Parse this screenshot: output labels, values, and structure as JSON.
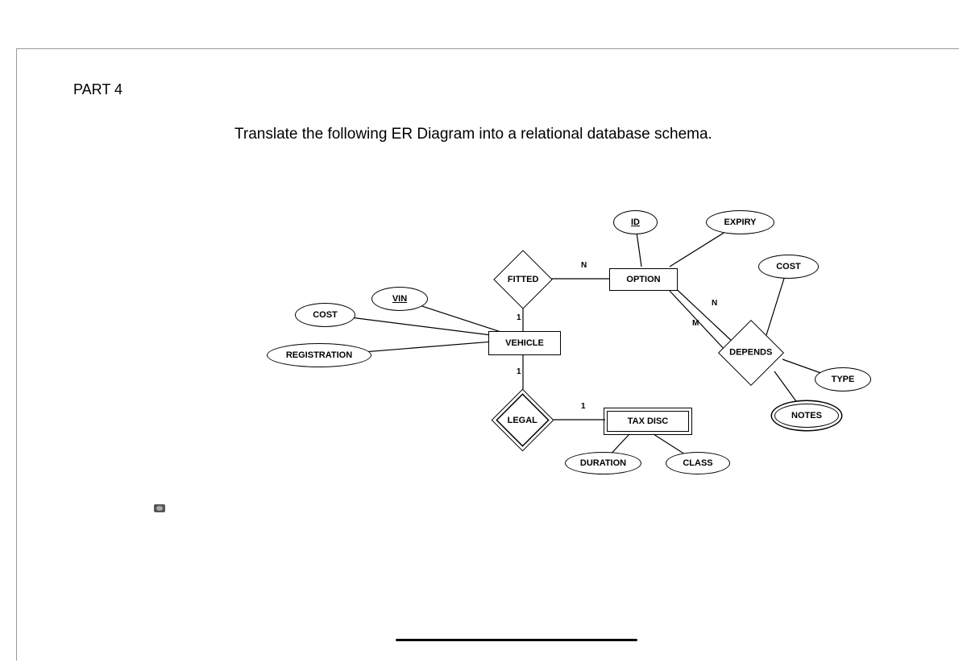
{
  "header": {
    "part": "PART 4"
  },
  "prompt": "Translate the following ER Diagram into a relational database schema.",
  "er": {
    "entities": {
      "vehicle": "VEHICLE",
      "option": "OPTION",
      "tax_disc": "TAX DISC"
    },
    "relationships": {
      "fitted": "FITTED",
      "depends": "DEPENDS",
      "legal": "LEGAL"
    },
    "attributes": {
      "vin": "VIN",
      "cost_vehicle": "COST",
      "registration": "REGISTRATION",
      "id": "ID",
      "expiry": "EXPIRY",
      "cost_depends": "COST",
      "type": "TYPE",
      "notes": "NOTES",
      "duration": "DURATION",
      "class": "CLASS"
    },
    "cardinalities": {
      "fitted_vehicle": "1",
      "fitted_option": "N",
      "option_depends": "M",
      "depends_option": "N",
      "vehicle_legal": "1",
      "legal_taxdisc": "1"
    }
  }
}
